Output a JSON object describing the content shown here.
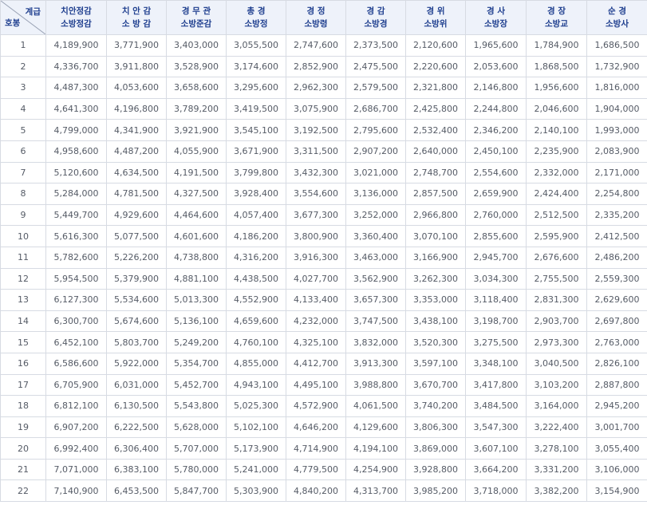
{
  "corner": {
    "grade_label": "계급",
    "step_label": "호봉"
  },
  "columns": [
    {
      "line1": "치안정감",
      "line2": "소방정감"
    },
    {
      "line1": "치 안 감",
      "line2": "소 방 감"
    },
    {
      "line1": "경 무 관",
      "line2": "소방준감"
    },
    {
      "line1": "총 경",
      "line2": "소방정"
    },
    {
      "line1": "경 정",
      "line2": "소방령"
    },
    {
      "line1": "경 감",
      "line2": "소방경"
    },
    {
      "line1": "경 위",
      "line2": "소방위"
    },
    {
      "line1": "경 사",
      "line2": "소방장"
    },
    {
      "line1": "경 장",
      "line2": "소방교"
    },
    {
      "line1": "순 경",
      "line2": "소방사"
    }
  ],
  "rows": [
    {
      "step": "1",
      "values": [
        "4,189,900",
        "3,771,900",
        "3,403,000",
        "3,055,500",
        "2,747,600",
        "2,373,500",
        "2,120,600",
        "1,965,600",
        "1,784,900",
        "1,686,500"
      ]
    },
    {
      "step": "2",
      "values": [
        "4,336,700",
        "3,911,800",
        "3,528,900",
        "3,174,600",
        "2,852,900",
        "2,475,500",
        "2,220,600",
        "2,053,600",
        "1,868,500",
        "1,732,900"
      ]
    },
    {
      "step": "3",
      "values": [
        "4,487,300",
        "4,053,600",
        "3,658,600",
        "3,295,600",
        "2,962,300",
        "2,579,500",
        "2,321,800",
        "2,146,800",
        "1,956,600",
        "1,816,000"
      ]
    },
    {
      "step": "4",
      "values": [
        "4,641,300",
        "4,196,800",
        "3,789,200",
        "3,419,500",
        "3,075,900",
        "2,686,700",
        "2,425,800",
        "2,244,800",
        "2,046,600",
        "1,904,000"
      ]
    },
    {
      "step": "5",
      "values": [
        "4,799,000",
        "4,341,900",
        "3,921,900",
        "3,545,100",
        "3,192,500",
        "2,795,600",
        "2,532,400",
        "2,346,200",
        "2,140,100",
        "1,993,000"
      ]
    },
    {
      "step": "6",
      "values": [
        "4,958,600",
        "4,487,200",
        "4,055,900",
        "3,671,900",
        "3,311,500",
        "2,907,200",
        "2,640,000",
        "2,450,100",
        "2,235,900",
        "2,083,900"
      ]
    },
    {
      "step": "7",
      "values": [
        "5,120,600",
        "4,634,500",
        "4,191,500",
        "3,799,800",
        "3,432,300",
        "3,021,000",
        "2,748,700",
        "2,554,600",
        "2,332,000",
        "2,171,000"
      ]
    },
    {
      "step": "8",
      "values": [
        "5,284,000",
        "4,781,500",
        "4,327,500",
        "3,928,400",
        "3,554,600",
        "3,136,000",
        "2,857,500",
        "2,659,900",
        "2,424,400",
        "2,254,800"
      ]
    },
    {
      "step": "9",
      "values": [
        "5,449,700",
        "4,929,600",
        "4,464,600",
        "4,057,400",
        "3,677,300",
        "3,252,000",
        "2,966,800",
        "2,760,000",
        "2,512,500",
        "2,335,200"
      ]
    },
    {
      "step": "10",
      "values": [
        "5,616,300",
        "5,077,500",
        "4,601,600",
        "4,186,200",
        "3,800,900",
        "3,360,400",
        "3,070,100",
        "2,855,600",
        "2,595,900",
        "2,412,500"
      ]
    },
    {
      "step": "11",
      "values": [
        "5,782,600",
        "5,226,200",
        "4,738,800",
        "4,316,200",
        "3,916,300",
        "3,463,000",
        "3,166,900",
        "2,945,700",
        "2,676,600",
        "2,486,200"
      ]
    },
    {
      "step": "12",
      "values": [
        "5,954,500",
        "5,379,900",
        "4,881,100",
        "4,438,500",
        "4,027,700",
        "3,562,900",
        "3,262,300",
        "3,034,300",
        "2,755,500",
        "2,559,300"
      ]
    },
    {
      "step": "13",
      "values": [
        "6,127,300",
        "5,534,600",
        "5,013,300",
        "4,552,900",
        "4,133,400",
        "3,657,300",
        "3,353,000",
        "3,118,400",
        "2,831,300",
        "2,629,600"
      ]
    },
    {
      "step": "14",
      "values": [
        "6,300,700",
        "5,674,600",
        "5,136,100",
        "4,659,600",
        "4,232,000",
        "3,747,500",
        "3,438,100",
        "3,198,700",
        "2,903,700",
        "2,697,800"
      ]
    },
    {
      "step": "15",
      "values": [
        "6,452,100",
        "5,803,700",
        "5,249,200",
        "4,760,100",
        "4,325,100",
        "3,832,000",
        "3,520,300",
        "3,275,500",
        "2,973,300",
        "2,763,000"
      ]
    },
    {
      "step": "16",
      "values": [
        "6,586,600",
        "5,922,000",
        "5,354,700",
        "4,855,000",
        "4,412,700",
        "3,913,300",
        "3,597,100",
        "3,348,100",
        "3,040,500",
        "2,826,100"
      ]
    },
    {
      "step": "17",
      "values": [
        "6,705,900",
        "6,031,000",
        "5,452,700",
        "4,943,100",
        "4,495,100",
        "3,988,800",
        "3,670,700",
        "3,417,800",
        "3,103,200",
        "2,887,800"
      ]
    },
    {
      "step": "18",
      "values": [
        "6,812,100",
        "6,130,500",
        "5,543,800",
        "5,025,300",
        "4,572,900",
        "4,061,500",
        "3,740,200",
        "3,484,500",
        "3,164,000",
        "2,945,200"
      ]
    },
    {
      "step": "19",
      "values": [
        "6,907,200",
        "6,222,500",
        "5,628,000",
        "5,102,100",
        "4,646,200",
        "4,129,600",
        "3,806,300",
        "3,547,300",
        "3,222,400",
        "3,001,700"
      ]
    },
    {
      "step": "20",
      "values": [
        "6,992,400",
        "6,306,400",
        "5,707,000",
        "5,173,900",
        "4,714,900",
        "4,194,100",
        "3,869,000",
        "3,607,100",
        "3,278,100",
        "3,055,400"
      ]
    },
    {
      "step": "21",
      "values": [
        "7,071,000",
        "6,383,100",
        "5,780,000",
        "5,241,000",
        "4,779,500",
        "4,254,900",
        "3,928,800",
        "3,664,200",
        "3,331,200",
        "3,106,000"
      ]
    },
    {
      "step": "22",
      "values": [
        "7,140,900",
        "6,453,500",
        "5,847,700",
        "5,303,900",
        "4,840,200",
        "4,313,700",
        "3,985,200",
        "3,718,000",
        "3,382,200",
        "3,154,900"
      ]
    }
  ]
}
